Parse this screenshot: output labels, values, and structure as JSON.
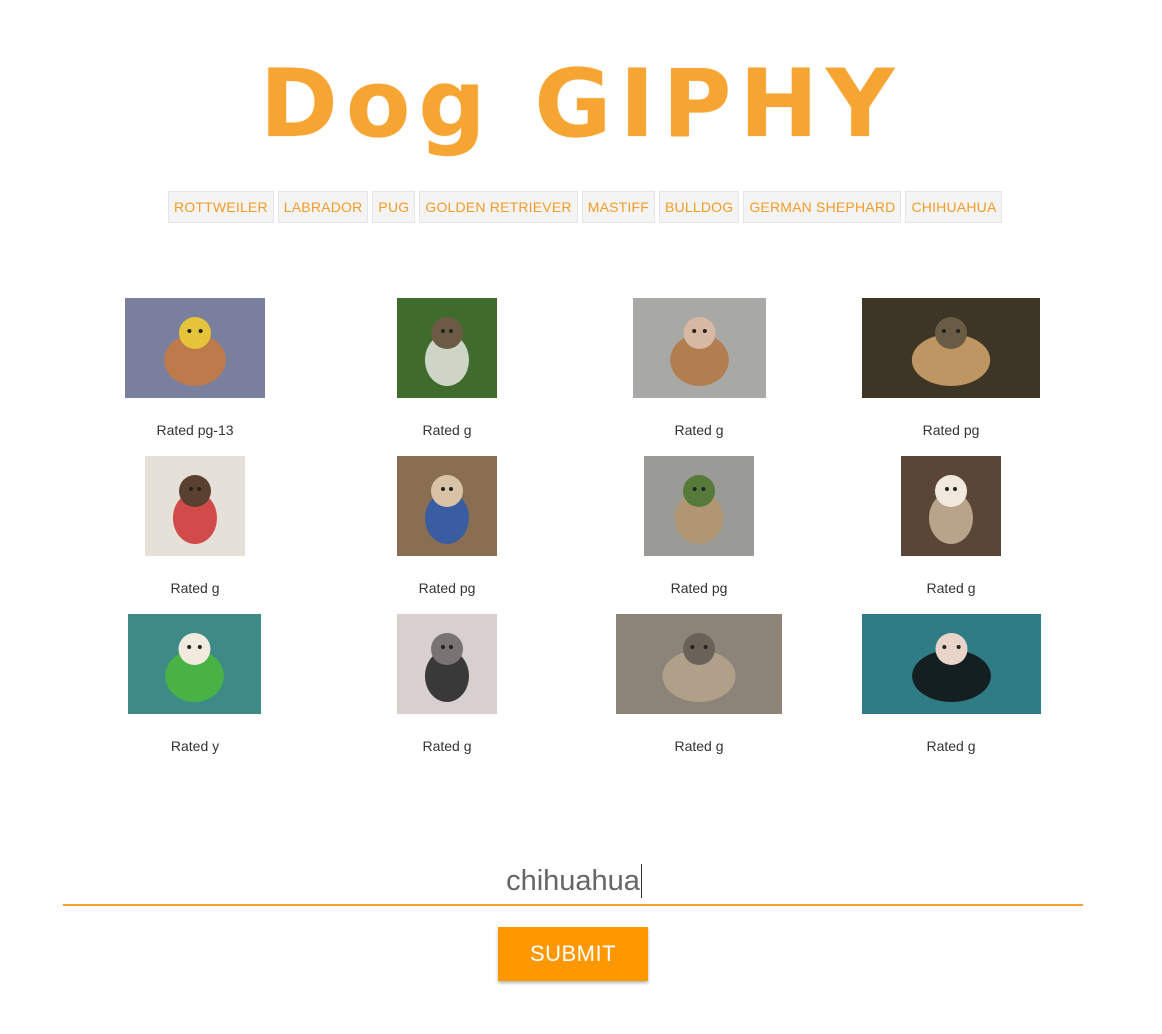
{
  "header": {
    "title": "Dog GIPHY"
  },
  "breeds": [
    "ROTTWEILER",
    "LABRADOR",
    "PUG",
    "GOLDEN RETRIEVER",
    "MASTIFF",
    "BULLDOG",
    "GERMAN SHEPHARD",
    "CHIHUAHUA"
  ],
  "gifs": [
    {
      "rating": "Rated pg-13",
      "palette": [
        "#7a7f9e",
        "#c9793b",
        "#e5c33a"
      ],
      "subject": "chihuahua-in-costume"
    },
    {
      "rating": "Rated g",
      "palette": [
        "#3f6b2c",
        "#e9e7e2",
        "#6b5b45"
      ],
      "subject": "chihuahua-on-grass"
    },
    {
      "rating": "Rated g",
      "palette": [
        "#a8a8a6",
        "#b4763f",
        "#d7b9a3"
      ],
      "subject": "chihuahua-hand"
    },
    {
      "rating": "Rated pg",
      "palette": [
        "#3d3526",
        "#d3a76f",
        "#6a5b44"
      ],
      "subject": "puppy-on-floor"
    },
    {
      "rating": "Rated g",
      "palette": [
        "#e5e0d8",
        "#cc3030",
        "#5a4030"
      ],
      "subject": "dogs-with-popcorn"
    },
    {
      "rating": "Rated pg",
      "palette": [
        "#8a6e52",
        "#2b5bb0",
        "#d9c3a6"
      ],
      "subject": "superman-chihuahua"
    },
    {
      "rating": "Rated pg",
      "palette": [
        "#9a9b97",
        "#b5956c",
        "#567a3a"
      ],
      "subject": "dog-on-sidewalk"
    },
    {
      "rating": "Rated g",
      "palette": [
        "#5a4636",
        "#c8b59a",
        "#f1e9dd"
      ],
      "subject": "puppy-on-couch"
    },
    {
      "rating": "Rated y",
      "palette": [
        "#3d8a86",
        "#4bb83a",
        "#f0ebde"
      ],
      "subject": "chihuahua-green-toy"
    },
    {
      "rating": "Rated g",
      "palette": [
        "#d8cfcf",
        "#1e1e1e",
        "#7a7373"
      ],
      "subject": "chihuahua-zebra"
    },
    {
      "rating": "Rated g",
      "palette": [
        "#8c8479",
        "#b6a48d",
        "#6a6159"
      ],
      "subject": "chihuahua-yoga"
    },
    {
      "rating": "Rated g",
      "palette": [
        "#2f7c86",
        "#0f0f0f",
        "#e8d4c9"
      ],
      "subject": "chihuahua-swimming"
    }
  ],
  "search": {
    "value": "chihuahua"
  },
  "submit": {
    "label": "SUBMIT"
  }
}
